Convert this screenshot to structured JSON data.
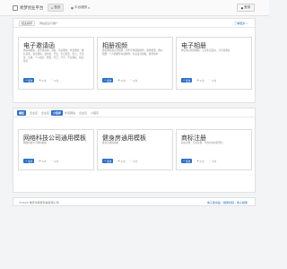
{
  "header": {
    "logo_text": "易梦创业平台",
    "home_label": "首页",
    "menu_label": "平台服务",
    "login_label": "登录"
  },
  "panel1": {
    "tabs": [
      "招业指导",
      "网站建设与推广"
    ],
    "more_label": "了解更多 »",
    "cards": [
      {
        "title": "电子邀请函",
        "desc": "邀请函模板、商务邀请函、请帖、活动邀约、年会邀请、婚礼请柬、会议邀请、发布会、开业、生日宴会、生日、宝宝宴、庆典、个人展览、聚会、乔迁、升学、毕业典礼、校庆等等",
        "btn": "使用",
        "views": "0/次",
        "likes": "0/次"
      },
      {
        "title": "相册视频",
        "desc": "微信网页版音乐相册、商务宣传视频制作、旅游相册、婚纱相册、个人相册等在线制作，专业设计模板，操作简单",
        "btn": "使用",
        "views": "0/次",
        "likes": "0/次"
      },
      {
        "title": "电子相册",
        "desc": "微信电子相册模板、记录生活美好、分享给朋友",
        "btn": "使用",
        "views": "0/次",
        "likes": "0/次"
      }
    ]
  },
  "panel2": {
    "tabs": [
      "模板",
      "企业名",
      "企业名",
      "小程序",
      "外贸网站",
      "企业名",
      "小程序"
    ],
    "cards": [
      {
        "title": "网络科技公司通用模板",
        "desc": "网络科技公司通用模板",
        "btn": "使用",
        "views": "0/次",
        "likes": "0/次"
      },
      {
        "title": "健身房通用模板",
        "desc": "健身房通用模板",
        "btn": "使用",
        "views": "0/次",
        "likes": "0/次"
      },
      {
        "title": "商标注册",
        "desc": "商标注册、企业注册、代办营业执照登记",
        "btn": "使用",
        "views": "0/次",
        "likes": "0/次"
      }
    ]
  },
  "footer": {
    "copyright": "©2023 重庆市易梦科技有限公司",
    "links": [
      "电子邀请函",
      "相册视频",
      "电子相册"
    ]
  },
  "colors": {
    "accent": "#2d6fc4",
    "background": "#f3f4f6"
  },
  "icons": {
    "use": "plus-icon",
    "views": "eye-icon",
    "likes": "heart-icon"
  }
}
